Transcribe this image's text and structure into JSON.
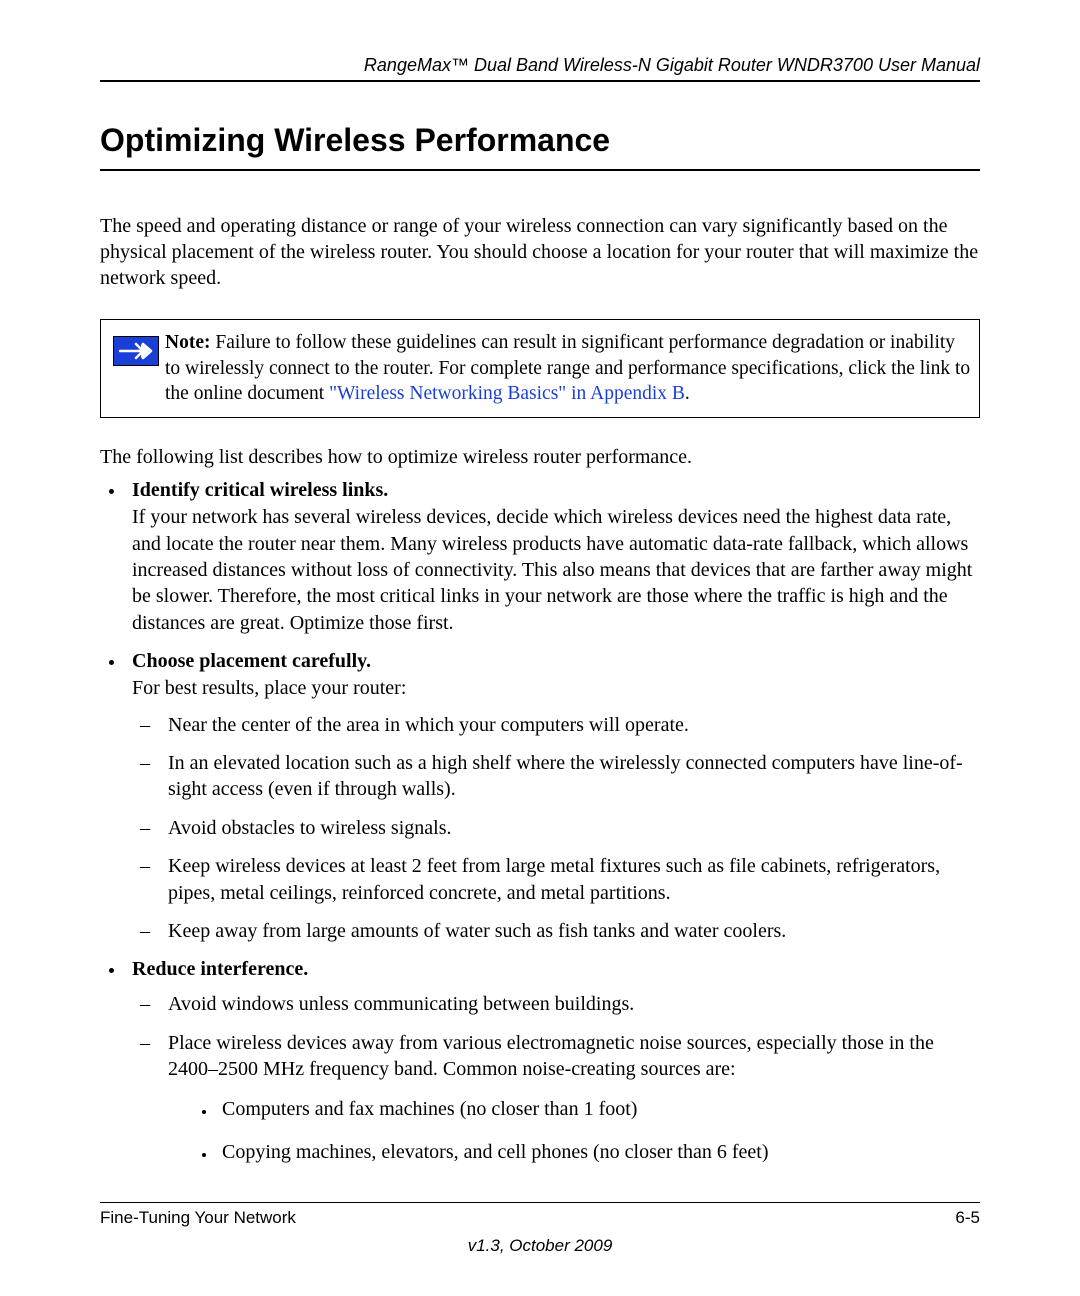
{
  "header": {
    "doc_title": "RangeMax™ Dual Band Wireless-N Gigabit Router WNDR3700 User Manual"
  },
  "section": {
    "title": "Optimizing Wireless Performance",
    "intro": "The speed and operating distance or range of your wireless connection can vary significantly based on the physical placement of the wireless router. You should choose a location for your router that will maximize the network speed."
  },
  "note": {
    "label": "Note:",
    "text_part1": " Failure to follow these guidelines can result in significant performance degradation or inability to wirelessly connect to the router. For complete range and performance specifications, click the link to the online document ",
    "link_text": "\"Wireless Networking Basics\" in Appendix B",
    "text_part2": "."
  },
  "lead_in": "The following list describes how to optimize wireless router performance.",
  "bullets": {
    "b1": {
      "title": "Identify critical wireless links.",
      "body": "If your network has several wireless devices, decide which wireless devices need the highest data rate, and locate the router near them. Many wireless products have automatic data-rate fallback, which allows increased distances without loss of connectivity. This also means that devices that are farther away might be slower. Therefore, the most critical links in your network are those where the traffic is high and the distances are great. Optimize those first."
    },
    "b2": {
      "title": "Choose placement carefully.",
      "body": "For best results, place your router:",
      "sub": {
        "s1": "Near the center of the area in which your computers will operate.",
        "s2": "In an elevated location such as a high shelf where the wirelessly connected computers have line-of-sight access (even if through walls).",
        "s3": "Avoid obstacles to wireless signals.",
        "s4": "Keep wireless devices at least 2 feet from large metal fixtures such as file cabinets, refrigerators, pipes, metal ceilings, reinforced concrete, and metal partitions.",
        "s5": "Keep away from large amounts of water such as fish tanks and water coolers."
      }
    },
    "b3": {
      "title": "Reduce interference.",
      "sub": {
        "s1": "Avoid windows unless communicating between buildings.",
        "s2": "Place wireless devices away from various electromagnetic noise sources, especially those in the 2400–2500 MHz frequency band. Common noise-creating sources are:",
        "subsub": {
          "ss1": "Computers and fax machines (no closer than 1 foot)",
          "ss2": "Copying machines, elevators, and cell phones (no closer than 6 feet)"
        }
      }
    }
  },
  "footer": {
    "chapter": "Fine-Tuning Your Network",
    "page": "6-5",
    "version": "v1.3, October 2009"
  }
}
